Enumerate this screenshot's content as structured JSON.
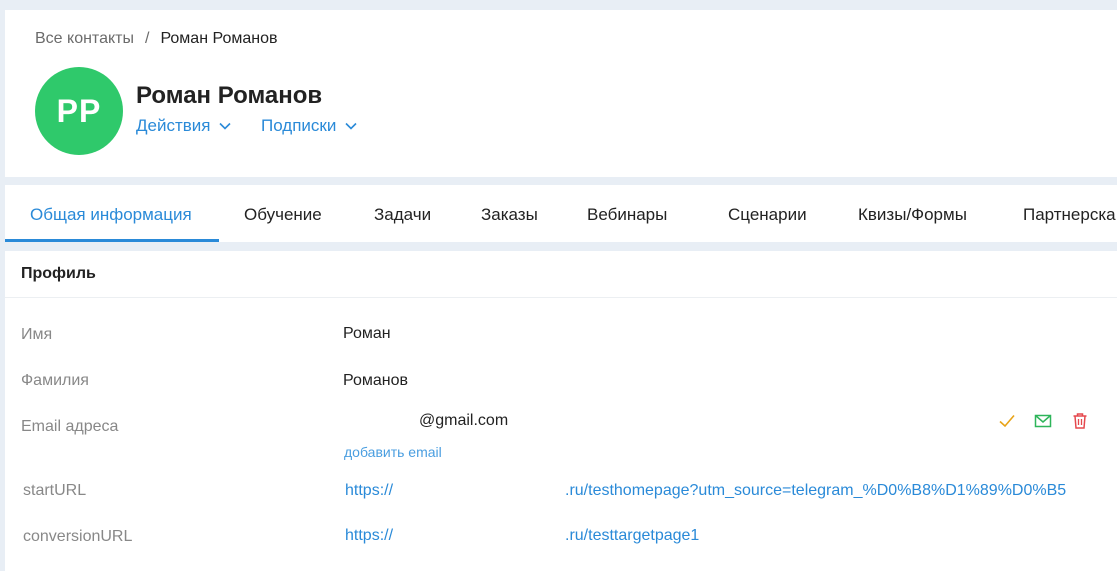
{
  "breadcrumb": {
    "parent": "Все контакты",
    "separator": "/",
    "current": "Роман Романов"
  },
  "contact": {
    "initials": "PP",
    "avatar_color": "#2fc96b",
    "name": "Роман Романов",
    "actions_label": "Действия",
    "subscriptions_label": "Подписки"
  },
  "tabs": [
    {
      "label": "Общая информация",
      "active": true
    },
    {
      "label": "Обучение"
    },
    {
      "label": "Задачи"
    },
    {
      "label": "Заказы"
    },
    {
      "label": "Вебинары"
    },
    {
      "label": "Сценарии"
    },
    {
      "label": "Квизы/Формы"
    },
    {
      "label": "Партнерска"
    }
  ],
  "profile": {
    "title": "Профиль",
    "first_name": {
      "label": "Имя",
      "value": "Роман"
    },
    "last_name": {
      "label": "Фамилия",
      "value": "Романов"
    },
    "email": {
      "label": "Email адреса",
      "value": "@gmail.com",
      "add_label": "добавить email"
    },
    "start_url": {
      "label": "startURL",
      "prefix": "https://",
      "suffix": ".ru/testhomepage?utm_source=telegram_%D0%B8%D1%89%D0%B5"
    },
    "conversion_url": {
      "label": "conversionURL",
      "prefix": "https://",
      "suffix": ".ru/testtargetpage1"
    }
  },
  "icons": {
    "verify": "check-icon",
    "send": "mail-icon",
    "delete": "trash-icon"
  },
  "colors": {
    "accent": "#2a8ad8",
    "check": "#e8a317",
    "mail": "#2eb55a",
    "delete": "#e5484d"
  }
}
